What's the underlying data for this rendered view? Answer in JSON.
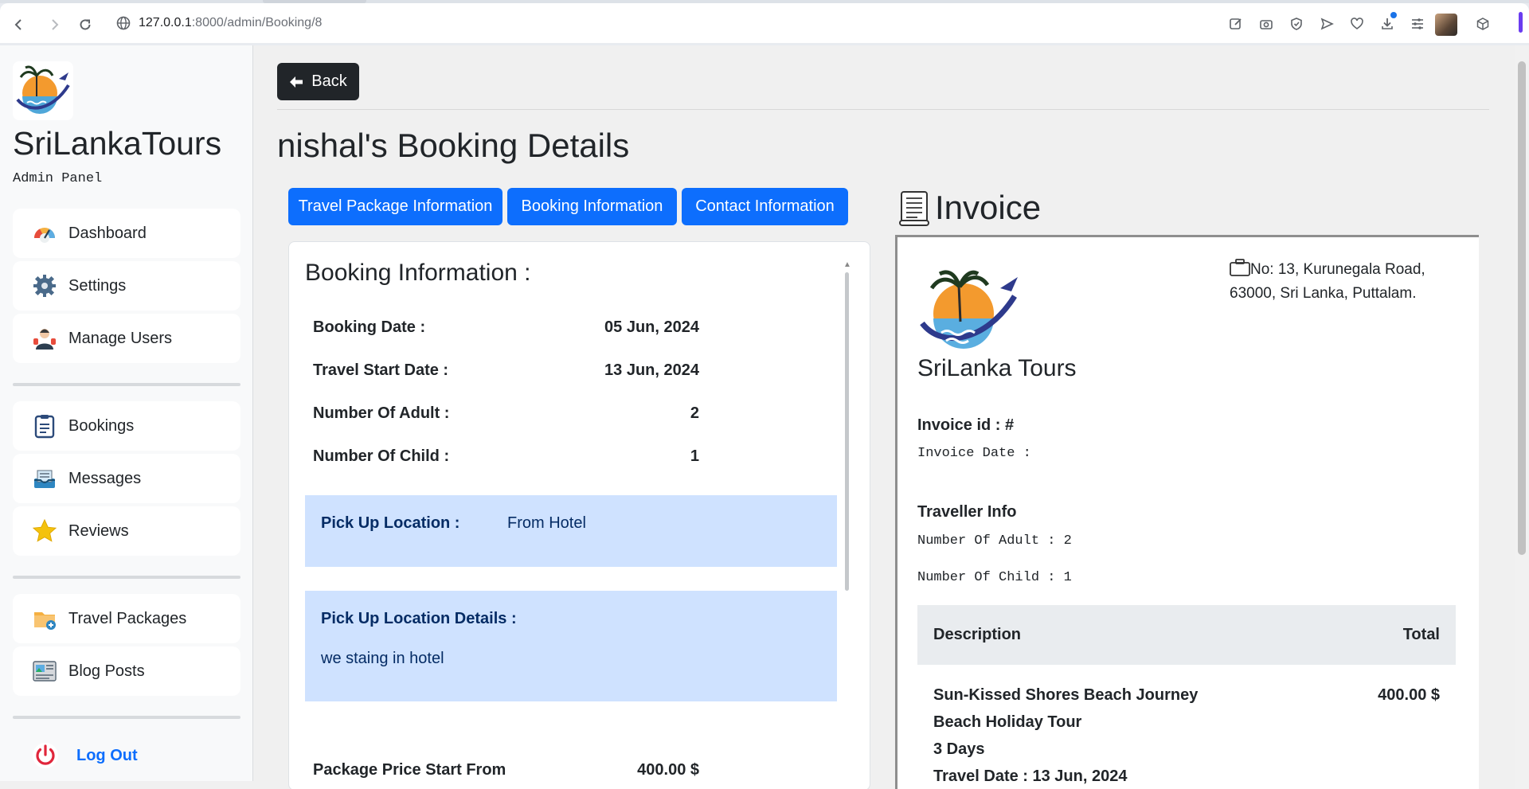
{
  "browser": {
    "url_host": "127.0.0.1",
    "url_path": ":8000/admin/Booking/8"
  },
  "sidebar": {
    "brand": "SriLankaTours",
    "subtitle": "Admin Panel",
    "items": [
      {
        "label": "Dashboard",
        "icon": "dashboard-icon"
      },
      {
        "label": "Settings",
        "icon": "gear-icon"
      },
      {
        "label": "Manage Users",
        "icon": "users-icon"
      },
      {
        "label": "Bookings",
        "icon": "clipboard-icon"
      },
      {
        "label": "Messages",
        "icon": "inbox-icon"
      },
      {
        "label": "Reviews",
        "icon": "star-icon"
      },
      {
        "label": "Travel Packages",
        "icon": "package-icon"
      },
      {
        "label": "Blog Posts",
        "icon": "blog-icon"
      }
    ],
    "logout": "Log Out"
  },
  "main": {
    "back": "Back",
    "title_name": "nishal",
    "title_rest": "'s Booking Details",
    "tabs": [
      "Travel Package Information",
      "Booking Information",
      "Contact Information"
    ]
  },
  "booking": {
    "heading": "Booking Information :",
    "rows": [
      {
        "label": "Booking Date :",
        "value": "05 Jun, 2024"
      },
      {
        "label": "Travel Start Date :",
        "value": "13 Jun, 2024"
      },
      {
        "label": "Number Of Adult :",
        "value": "2"
      },
      {
        "label": "Number Of Child :",
        "value": "1"
      }
    ],
    "pickup_label": "Pick Up Location :",
    "pickup_value": "From Hotel",
    "pickup_details_label": "Pick Up Location Details :",
    "pickup_details_value": "we staing in hotel",
    "price_label": "Package Price Start From",
    "price_value": "400.00 $"
  },
  "invoice": {
    "title": "Invoice",
    "address": "No: 13, Kurunegala Road, 63000, Sri Lanka, Puttalam.",
    "brand": "SriLanka Tours",
    "id_label": "Invoice id : #",
    "date_label": "Invoice Date :",
    "traveller_heading": "Traveller Info",
    "adult_line": "Number Of Adult : 2",
    "child_line": "Number Of Child : 1",
    "col_description": "Description",
    "col_total": "Total",
    "item_name": "Sun-Kissed Shores Beach Journey",
    "item_total": "400.00 $",
    "item_type": "Beach Holiday Tour",
    "item_duration": "3 Days",
    "item_travel_date": "Travel Date : 13 Jun, 2024"
  },
  "colors": {
    "primary": "#0d6efd",
    "dark": "#212529",
    "highlight": "#cfe2ff",
    "table_head": "#e9ecef"
  }
}
